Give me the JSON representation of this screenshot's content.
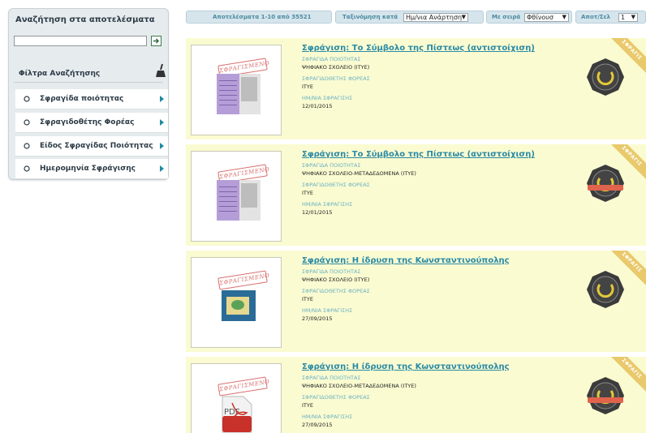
{
  "sidebar": {
    "title": "Αναζήτηση στα αποτελέσματα",
    "search": {
      "value": "",
      "placeholder": ""
    },
    "filters_title": "Φίλτρα Αναζήτησης",
    "items": [
      {
        "label": "Σφραγίδα ποιότητας"
      },
      {
        "label": "Σφραγιδοθέτης Φορέας"
      },
      {
        "label": "Είδος Σφραγίδας Ποιότητας"
      },
      {
        "label": "Ημερομηνία Σφράγισης"
      }
    ]
  },
  "toolbar": {
    "results_text": "Αποτελέσματα 1-10 από 35521",
    "sort_label": "Ταξινόμηση κατά",
    "sort_value": "Ημ/νια Ανάρτηση",
    "order_label": "Με σειρά",
    "order_value": "Φθίνουσ",
    "per_page_label": "Αποτ/Σελ",
    "per_page_value": "1"
  },
  "results": [
    {
      "title": "Σφράγιση: Το Σύμβολο της Πίστεως (αντιστοίχιση)",
      "seal_label": "ΣΦΡΑΓΙΔΑ ΠΟΙΟΤΗΤΑΣ",
      "seal_value": "ΨΗΦΙΑΚΟ ΣΧΟΛΕΙΟ (ΙΤΥΕ)",
      "org_label": "ΣΦΡΑΓΙΔΟΘΕΤΗΣ ΦΟΡΕΑΣ",
      "org_value": "ΙΤΥΕ",
      "date_label": "ΗΜ/ΝΙΑ ΣΦΡΑΓΙΣΗΣ",
      "date_value": "12/01/2015",
      "stamp": "ΣΦΡΑΓΙΣΜΕΝΟ",
      "corner": "ΣΦΡΑΓΙΣ"
    },
    {
      "title": "Σφράγιση: Το Σύμβολο της Πίστεως (αντιστοίχιση)",
      "seal_label": "ΣΦΡΑΓΙΔΑ ΠΟΙΟΤΗΤΑΣ",
      "seal_value": "ΨΗΦΙΑΚΟ ΣΧΟΛΕΙΟ-ΜΕΤΑΔΕΔΟΜΕΝΑ (ΙΤΥΕ)",
      "org_label": "ΣΦΡΑΓΙΔΟΘΕΤΗΣ ΦΟΡΕΑΣ",
      "org_value": "ΙΤΥΕ",
      "date_label": "ΗΜ/ΝΙΑ ΣΦΡΑΓΙΣΗΣ",
      "date_value": "12/01/2015",
      "stamp": "ΣΦΡΑΓΙΣΜΕΝΟ",
      "corner": "ΣΦΡΑΓΙΣ"
    },
    {
      "title": "Σφράγιση: Η ίδρυση της Κωνσταντινούπολης",
      "seal_label": "ΣΦΡΑΓΙΔΑ ΠΟΙΟΤΗΤΑΣ",
      "seal_value": "ΨΗΦΙΑΚΟ ΣΧΟΛΕΙΟ (ΙΤΥΕ)",
      "org_label": "ΣΦΡΑΓΙΔΟΘΕΤΗΣ ΦΟΡΕΑΣ",
      "org_value": "ΙΤΥΕ",
      "date_label": "ΗΜ/ΝΙΑ ΣΦΡΑΓΙΣΗΣ",
      "date_value": "27/09/2015",
      "stamp": "ΣΦΡΑΓΙΣΜΕΝΟ",
      "corner": "ΣΦΡΑΓΙΣ"
    },
    {
      "title": "Σφράγιση: Η ίδρυση της Κωνσταντινούπολης",
      "seal_label": "ΣΦΡΑΓΙΔΑ ΠΟΙΟΤΗΤΑΣ",
      "seal_value": "ΨΗΦΙΑΚΟ ΣΧΟΛΕΙΟ-ΜΕΤΑΔΕΔΟΜΕΝΑ (ΙΤΥΕ)",
      "org_label": "ΣΦΡΑΓΙΔΟΘΕΤΗΣ ΦΟΡΕΑΣ",
      "org_value": "ΙΤΥΕ",
      "date_label": "ΗΜ/ΝΙΑ ΣΦΡΑΓΙΣΗΣ",
      "date_value": "27/09/2015",
      "stamp": "ΣΦΡΑΓΙΣΜΕΝΟ",
      "corner": "ΣΦΡΑΓΙΣ",
      "thumb_text": "PDF"
    }
  ],
  "icons": {
    "go": "arrow-right-icon",
    "clear": "broom-icon",
    "filter": "refresh-icon",
    "expand": "triangle-right-icon"
  },
  "colors": {
    "card_bg": "#fafbd1",
    "link": "#2a8aa5",
    "label": "#6ab0c3",
    "stamp": "#d96f6f",
    "corner": "#e9c96c"
  }
}
